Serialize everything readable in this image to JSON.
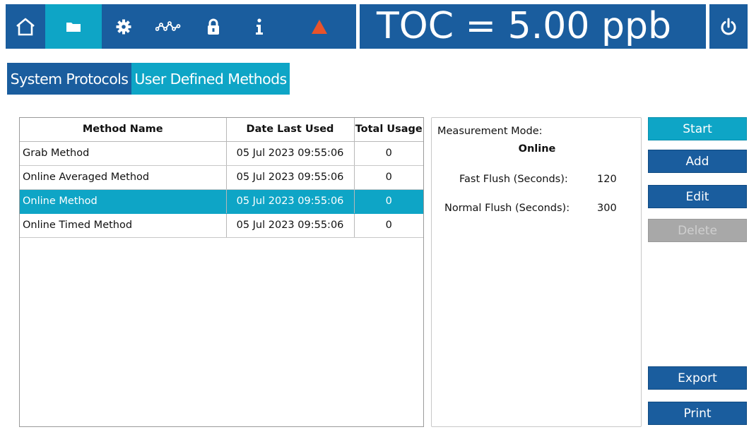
{
  "header": {
    "toc_readout": "TOC = 5.00 ppb",
    "nav": [
      {
        "name": "home-icon",
        "active": false
      },
      {
        "name": "folder-icon",
        "active": true
      },
      {
        "name": "gear-icon",
        "active": false
      },
      {
        "name": "trend-icon",
        "active": false
      },
      {
        "name": "lock-icon",
        "active": false
      },
      {
        "name": "info-icon",
        "active": false
      },
      {
        "name": "alarm-triangle-icon",
        "active": false
      }
    ],
    "power_icon": "power-icon",
    "colors": {
      "bar": "#1a5d9e",
      "active": "#0ea5c6",
      "alarm": "#e8532b"
    }
  },
  "tabs": {
    "system_protocols": "System Protocols",
    "user_defined_methods": "User Defined Methods"
  },
  "table": {
    "headers": {
      "name": "Method Name",
      "date": "Date Last Used",
      "usage": "Total Usage"
    },
    "rows": [
      {
        "name": "Grab Method",
        "date": "05 Jul 2023 09:55:06",
        "usage": "0",
        "selected": false
      },
      {
        "name": "Online Averaged Method",
        "date": "05 Jul 2023 09:55:06",
        "usage": "0",
        "selected": false
      },
      {
        "name": "Online Method",
        "date": "05 Jul 2023 09:55:06",
        "usage": "0",
        "selected": true
      },
      {
        "name": "Online Timed Method",
        "date": "05 Jul 2023 09:55:06",
        "usage": "0",
        "selected": false
      }
    ]
  },
  "details": {
    "mode_label": "Measurement Mode:",
    "mode_value": "Online",
    "fast_flush_label": "Fast Flush (Seconds):",
    "fast_flush_value": "120",
    "normal_flush_label": "Normal Flush (Seconds):",
    "normal_flush_value": "300"
  },
  "buttons": {
    "start": "Start",
    "add": "Add",
    "edit": "Edit",
    "delete": "Delete",
    "export": "Export",
    "print": "Print"
  }
}
